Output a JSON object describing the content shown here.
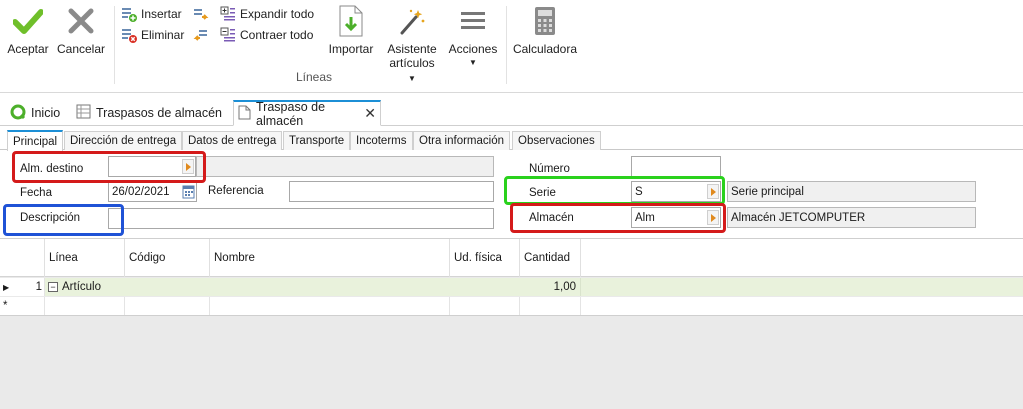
{
  "ribbon": {
    "accept": "Aceptar",
    "cancel": "Cancelar",
    "insert": "Insertar",
    "delete": "Eliminar",
    "expand_all": "Expandir todo",
    "collapse_all": "Contraer todo",
    "import": "Importar",
    "assistant_line1": "Asistente",
    "assistant_line2": "artículos",
    "actions": "Acciones",
    "calculator": "Calculadora",
    "group_lines": "Líneas"
  },
  "doc_tabs": {
    "home": "Inicio",
    "list": "Traspasos de almacén",
    "current": "Traspaso de almacén"
  },
  "sub_tabs": [
    "Principal",
    "Dirección de entrega",
    "Datos de entrega",
    "Transporte",
    "Incoterms",
    "Otra información",
    "Observaciones"
  ],
  "form": {
    "dest_warehouse_label": "Alm. destino",
    "dest_warehouse_value": "",
    "date_label": "Fecha",
    "date_value": "26/02/2021",
    "reference_label": "Referencia",
    "reference_value": "",
    "description_label": "Descripción",
    "description_value": "",
    "number_label": "Número",
    "number_value": "",
    "series_label": "Serie",
    "series_value": "S",
    "series_name": "Serie principal",
    "warehouse_label": "Almacén",
    "warehouse_value": "Alm",
    "warehouse_name": "Almacén JETCOMPUTER"
  },
  "grid": {
    "columns": [
      "Línea",
      "Código",
      "Nombre",
      "Ud. física",
      "Cantidad"
    ],
    "rows": [
      {
        "line": "1",
        "group_label": "Artículo",
        "quantity": "1,00"
      }
    ],
    "new_row_marker": "*"
  },
  "colors": {
    "accent": "#1c8fd6",
    "highlight_red": "#d41a1a",
    "highlight_blue": "#1f52d6",
    "highlight_green": "#2ad11d",
    "group_row": "#e9f2dc"
  }
}
